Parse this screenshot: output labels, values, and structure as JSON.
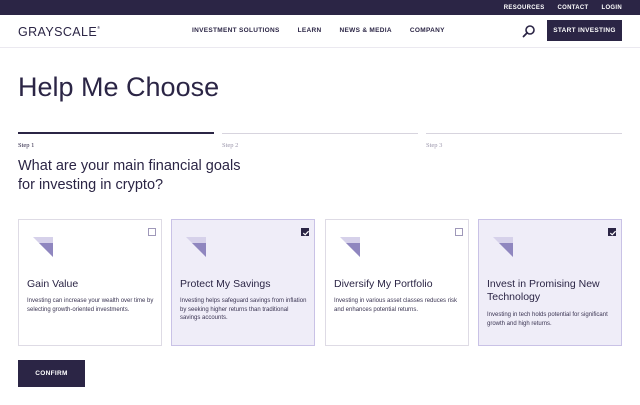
{
  "topbar": {
    "links": [
      "RESOURCES",
      "CONTACT",
      "LOGIN"
    ]
  },
  "nav": {
    "logo": "GRAYSCALE",
    "logo_mark": "®",
    "menu": [
      "INVESTMENT SOLUTIONS",
      "LEARN",
      "NEWS & MEDIA",
      "COMPANY"
    ],
    "search_icon": "search-icon",
    "cta_label": "START INVESTING"
  },
  "page": {
    "title": "Help Me Choose",
    "steps": [
      {
        "label": "Step 1",
        "active": true
      },
      {
        "label": "Step 2",
        "active": false
      },
      {
        "label": "Step 3",
        "active": false
      }
    ],
    "question": "What are your main financial goals for investing in crypto?"
  },
  "cards": [
    {
      "title": "Gain Value",
      "description": "Investing can increase your wealth over time by selecting growth-oriented investments.",
      "selected": false
    },
    {
      "title": "Protect My Savings",
      "description": "Investing helps safeguard savings from inflation by seeking higher returns than traditional savings accounts.",
      "selected": true
    },
    {
      "title": "Diversify My Portfolio",
      "description": "Investing in various asset classes reduces risk and enhances potential returns.",
      "selected": false
    },
    {
      "title": "Invest in Promising New Technology",
      "description": "Investing in tech holds potential for significant growth and high returns.",
      "selected": true
    }
  ],
  "confirm_label": "CONFIRM",
  "colors": {
    "brand": "#2b2545",
    "selected_bg": "#efedf8",
    "mark_light": "#d6d1ea",
    "mark_dark": "#8f86bf"
  }
}
